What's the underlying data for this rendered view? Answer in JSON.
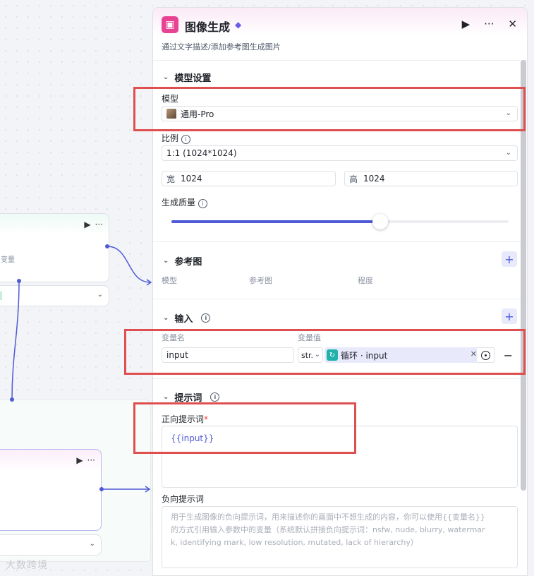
{
  "panel": {
    "title": "图像生成",
    "subtitle": "通过文字描述/添加参考图生成图片"
  },
  "model_settings": {
    "section_title": "模型设置",
    "model_label": "模型",
    "model_value": "通用-Pro",
    "ratio_label": "比例",
    "ratio_value": "1:1 (1024*1024)",
    "width_prefix": "宽",
    "width_value": "1024",
    "height_prefix": "高",
    "height_value": "1024",
    "quality_label": "生成质量",
    "quality_level": 0.62
  },
  "reference": {
    "section_title": "参考图",
    "col_model": "模型",
    "col_ref": "参考图",
    "col_degree": "程度"
  },
  "inputs": {
    "section_title": "输入",
    "col_name": "变量名",
    "col_value": "变量值",
    "row_name": "input",
    "row_type": "str.",
    "row_ref_label": "循环 · input"
  },
  "prompt": {
    "section_title": "提示词",
    "positive_label": "正向提示词",
    "required_mark": "*",
    "positive_value": "{{input}}",
    "negative_label": "负向提示词",
    "negative_placeholder_1": "用于生成图像的负向提示词，用来描述你的画面中不想生成的内容，你可以使用{{变量名}}",
    "negative_placeholder_2": "的方式引用输入参数中的变量（系统默认拼接负向提示词：nsfw, nude, blurry, watermar",
    "negative_placeholder_3": "k, identifying mark, low resolution, mutated, lack of hierarchy）"
  },
  "canvas": {
    "node1_text": "变量",
    "watermark": "大数跨境"
  }
}
